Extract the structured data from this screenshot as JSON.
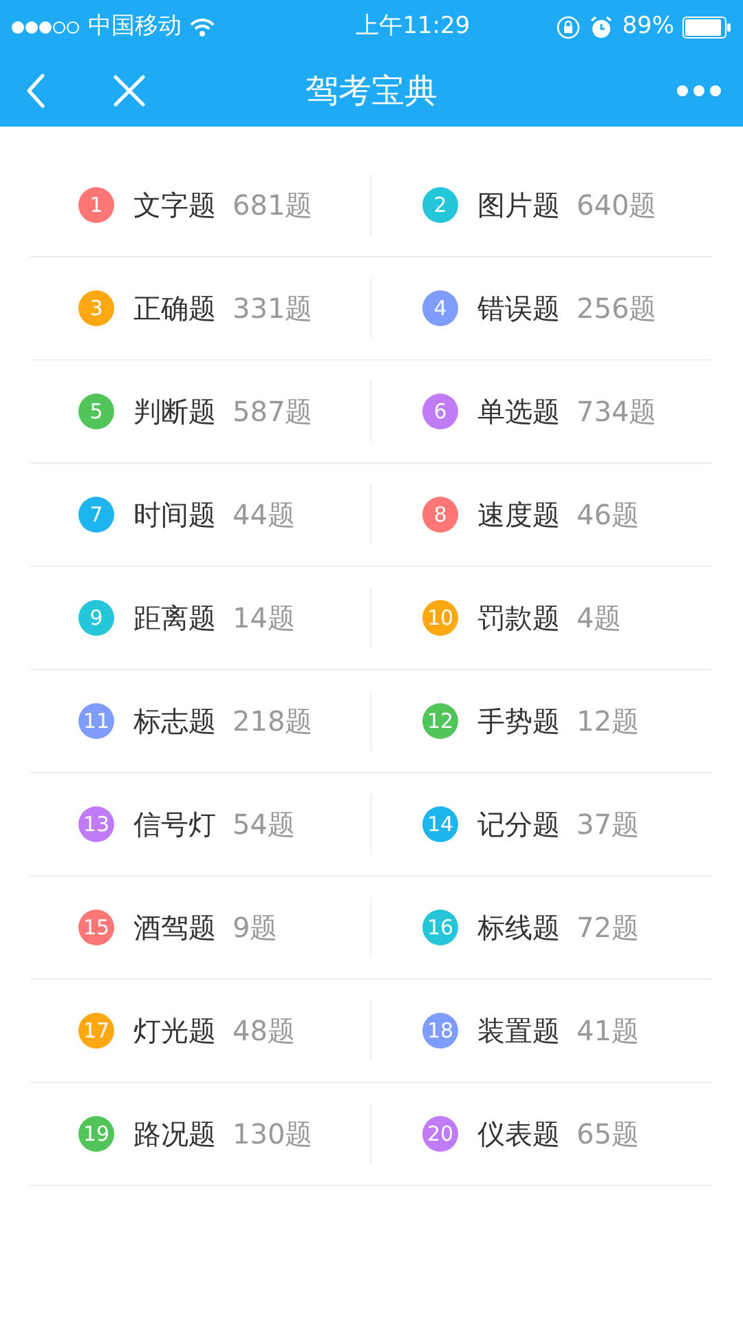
{
  "status_bar": {
    "carrier": "中国移动",
    "time": "上午11:29",
    "battery": "89%"
  },
  "nav": {
    "title": "驾考宝典"
  },
  "categories": [
    {
      "number": "1",
      "name": "文字题",
      "count": "681题",
      "color": "#ff7676"
    },
    {
      "number": "2",
      "name": "图片题",
      "count": "640题",
      "color": "#26c6da"
    },
    {
      "number": "3",
      "name": "正确题",
      "count": "331题",
      "color": "#ffa812"
    },
    {
      "number": "4",
      "name": "错误题",
      "count": "256题",
      "color": "#7f9cff"
    },
    {
      "number": "5",
      "name": "判断题",
      "count": "587题",
      "color": "#52c55a"
    },
    {
      "number": "6",
      "name": "单选题",
      "count": "734题",
      "color": "#c07cf6"
    },
    {
      "number": "7",
      "name": "时间题",
      "count": "44题",
      "color": "#1eb4ee"
    },
    {
      "number": "8",
      "name": "速度题",
      "count": "46题",
      "color": "#ff7676"
    },
    {
      "number": "9",
      "name": "距离题",
      "count": "14题",
      "color": "#26c6da"
    },
    {
      "number": "10",
      "name": "罚款题",
      "count": "4题",
      "color": "#ffa812"
    },
    {
      "number": "11",
      "name": "标志题",
      "count": "218题",
      "color": "#7f9cff"
    },
    {
      "number": "12",
      "name": "手势题",
      "count": "12题",
      "color": "#52c55a"
    },
    {
      "number": "13",
      "name": "信号灯",
      "count": "54题",
      "color": "#c07cf6"
    },
    {
      "number": "14",
      "name": "记分题",
      "count": "37题",
      "color": "#1eb4ee"
    },
    {
      "number": "15",
      "name": "酒驾题",
      "count": "9题",
      "color": "#ff7676"
    },
    {
      "number": "16",
      "name": "标线题",
      "count": "72题",
      "color": "#26c6da"
    },
    {
      "number": "17",
      "name": "灯光题",
      "count": "48题",
      "color": "#ffa812"
    },
    {
      "number": "18",
      "name": "装置题",
      "count": "41题",
      "color": "#7f9cff"
    },
    {
      "number": "19",
      "name": "路况题",
      "count": "130题",
      "color": "#52c55a"
    },
    {
      "number": "20",
      "name": "仪表题",
      "count": "65题",
      "color": "#c07cf6"
    }
  ]
}
